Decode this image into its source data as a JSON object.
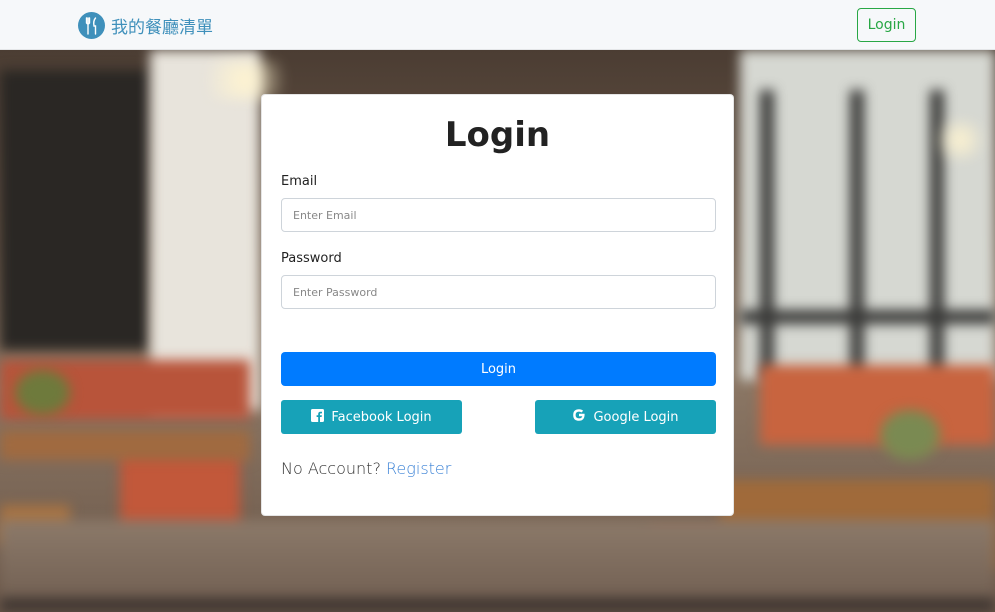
{
  "navbar": {
    "brand_name": "我的餐廳清單",
    "brand_icon": "fork-knife-icon",
    "login_label": "Login",
    "accent_color": "#3f90bb",
    "login_color": "#28a745"
  },
  "form": {
    "title": "Login",
    "email_label": "Email",
    "email_placeholder": "Enter Email",
    "password_label": "Password",
    "password_placeholder": "Enter Password",
    "submit_label": "Login",
    "facebook_label": "Facebook Login",
    "google_label": "Google Login",
    "no_account_text": "No Account?",
    "register_label": "Register",
    "primary_color": "#007bff",
    "social_color": "#17a2b8"
  }
}
